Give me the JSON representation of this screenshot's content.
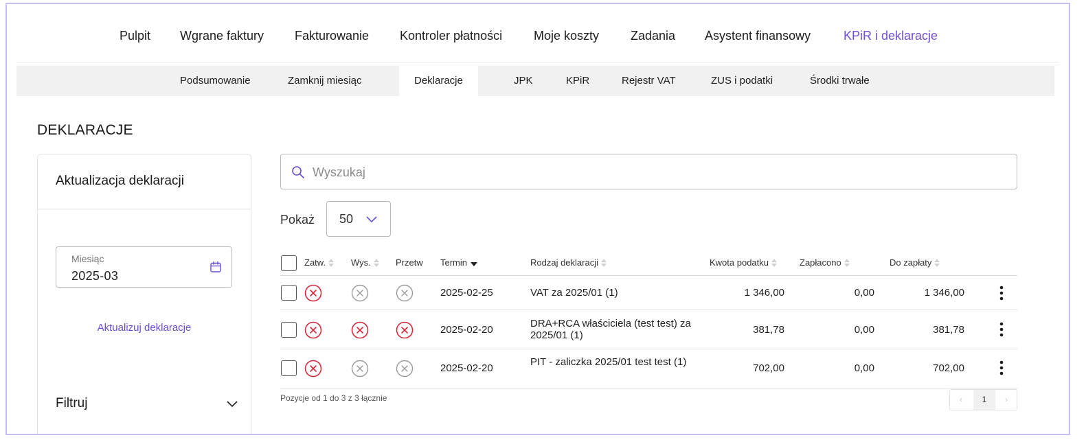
{
  "topnav": {
    "items": [
      {
        "label": "Pulpit"
      },
      {
        "label": "Wgrane faktury"
      },
      {
        "label": "Fakturowanie"
      },
      {
        "label": "Kontroler płatności"
      },
      {
        "label": "Moje koszty"
      },
      {
        "label": "Zadania"
      },
      {
        "label": "Asystent finansowy"
      },
      {
        "label": "KPiR i deklaracje",
        "active": true
      }
    ]
  },
  "subnav": {
    "items": [
      {
        "label": "Podsumowanie"
      },
      {
        "label": "Zamknij miesiąc"
      },
      {
        "label": "Deklaracje",
        "active": true
      },
      {
        "label": "JPK"
      },
      {
        "label": "KPiR"
      },
      {
        "label": "Rejestr VAT"
      },
      {
        "label": "ZUS i podatki"
      },
      {
        "label": "Środki trwałe"
      }
    ]
  },
  "page_title": "DEKLARACJE",
  "panel": {
    "title": "Aktualizacja deklaracji",
    "month_label": "Miesiąc",
    "month_value": "2025-03",
    "update_link": "Aktualizuj deklaracje",
    "filter_label": "Filtruj"
  },
  "search": {
    "placeholder": "Wyszukaj",
    "value": ""
  },
  "show": {
    "label": "Pokaż",
    "value": "50"
  },
  "table": {
    "headers": {
      "approved": "Zatw.",
      "sent": "Wys.",
      "processed": "Przetw",
      "due": "Termin",
      "type": "Rodzaj deklaracji",
      "tax": "Kwota podatku",
      "paid": "Zapłacono",
      "to_pay": "Do zapłaty"
    },
    "rows": [
      {
        "approved": "red",
        "sent": "grey",
        "processed": "grey",
        "due": "2025-02-25",
        "type": "VAT za 2025/01 (1)",
        "tax": "1 346,00",
        "paid": "0,00",
        "to_pay": "1 346,00"
      },
      {
        "approved": "red",
        "sent": "red",
        "processed": "red",
        "due": "2025-02-20",
        "type": "DRA+RCA właściciela (test test) za 2025/01 (1)",
        "tax": "381,78",
        "paid": "0,00",
        "to_pay": "381,78"
      },
      {
        "approved": "red",
        "sent": "grey",
        "processed": "grey",
        "due": "2025-02-20",
        "type": "PIT - zaliczka 2025/01 test test (1)",
        "tax": "702,00",
        "paid": "0,00",
        "to_pay": "702,00"
      }
    ]
  },
  "footer": {
    "info": "Pozycje od 1 do 3 z 3 łącznie",
    "prev": "‹",
    "page": "1",
    "next": "›"
  },
  "colors": {
    "accent": "#7150d6",
    "status_red": "#d6283a",
    "status_grey": "#9a9a9a",
    "frame": "#c7c0f0"
  }
}
